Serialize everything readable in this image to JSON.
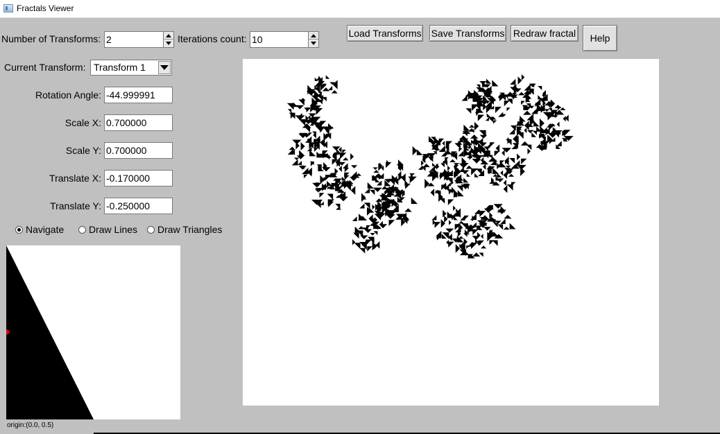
{
  "window": {
    "title": "Fractals Viewer",
    "icon": "app-window-icon"
  },
  "controls": {
    "num_transforms_label": "Number of Transforms:",
    "num_transforms_value": "2",
    "iterations_label": "Iterations count:",
    "iterations_value": "10",
    "current_transform_label": "Current Transform:",
    "current_transform_value": "Transform 1",
    "rotation_label": "Rotation Angle:",
    "rotation_value": "-44.999991",
    "scale_x_label": "Scale X:",
    "scale_x_value": "0.700000",
    "scale_y_label": "Scale Y:",
    "scale_y_value": "0.700000",
    "translate_x_label": "Translate X:",
    "translate_x_value": "-0.170000",
    "translate_y_label": "Translate Y:",
    "translate_y_value": "-0.250000"
  },
  "buttons": {
    "load": "Load Transforms",
    "save": "Save Transforms",
    "redraw": "Redraw fractal",
    "help": "Help"
  },
  "modes": [
    {
      "label": "Navigate",
      "selected": true
    },
    {
      "label": "Draw Lines",
      "selected": false
    },
    {
      "label": "Draw Triangles",
      "selected": false
    }
  ],
  "preview": {
    "origin_label": "origin:(0.0, 0.5)",
    "marker_color": "#e00000"
  },
  "colors": {
    "window_bg": "#c0c0c0",
    "canvas_bg": "#ffffff",
    "fractal": "#000000"
  }
}
